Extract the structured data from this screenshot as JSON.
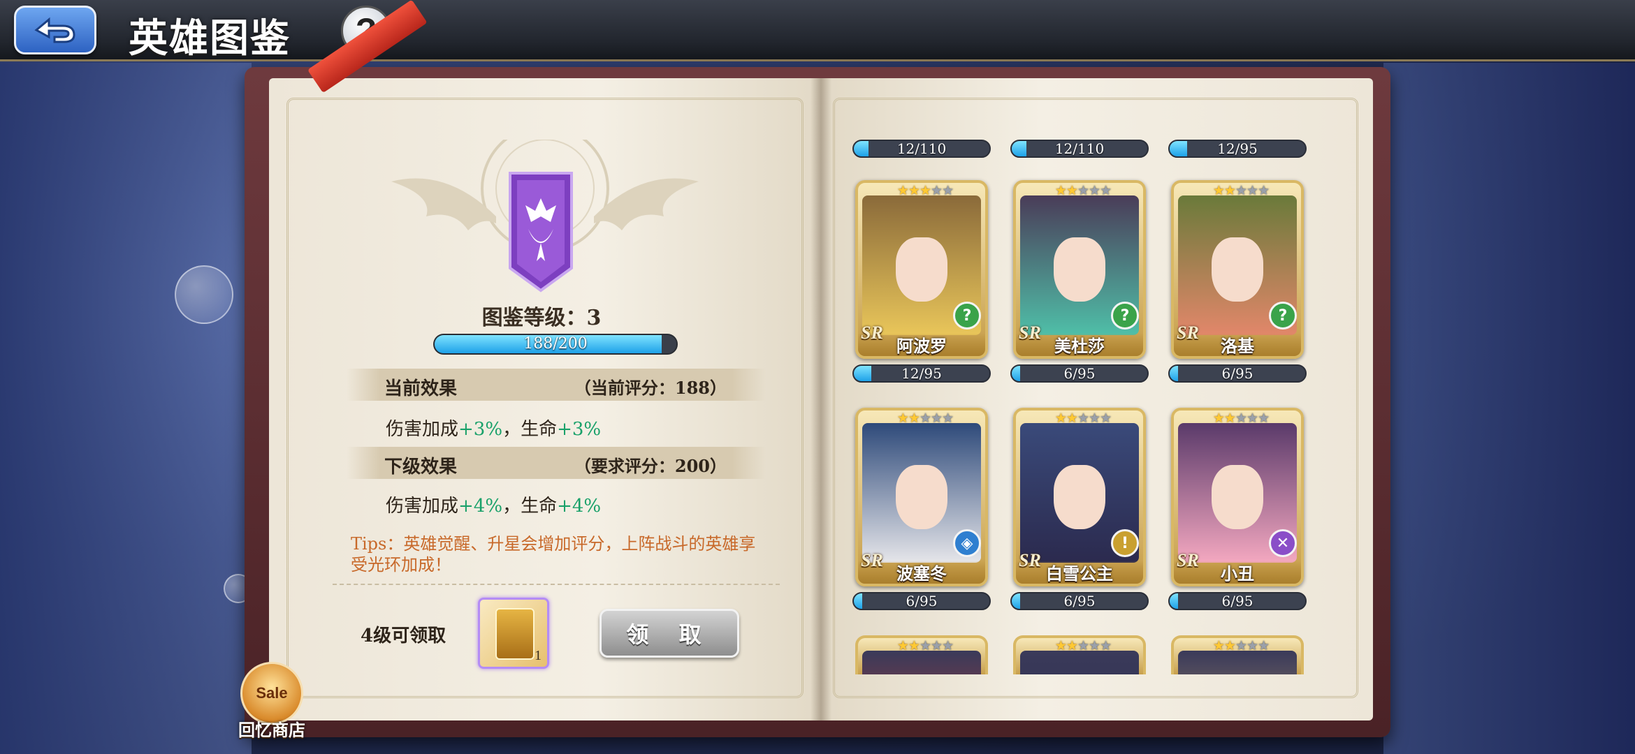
{
  "header": {
    "title": "英雄图鉴",
    "back_icon": "back-arrow-icon",
    "help_symbol": "?"
  },
  "collection": {
    "level_label": "图鉴等级：3",
    "progress_text": "188/200",
    "progress_fraction": 0.94,
    "current_effect": {
      "title": "当前效果",
      "score": "（当前评分：188）",
      "effect_prefix_1": "伤害加成",
      "effect_value_1": "+3%",
      "effect_mid": "，生命",
      "effect_value_2": "+3%"
    },
    "next_effect": {
      "title": "下级效果",
      "score": "（要求评分：200）",
      "effect_prefix_1": "伤害加成",
      "effect_value_1": "+4%",
      "effect_mid": "，生命",
      "effect_value_2": "+4%"
    },
    "tips": "Tips：英雄觉醒、升星会增加评分，上阵战斗的英雄享受光环加成！",
    "claim_condition": "4级可领取",
    "reward_count": "1",
    "claim_button": "领 取"
  },
  "shop": {
    "icon_text": "Sale",
    "label": "回忆商店"
  },
  "top_bars": [
    {
      "text": "12/110",
      "fraction": 0.11
    },
    {
      "text": "12/110",
      "fraction": 0.11
    },
    {
      "text": "12/95",
      "fraction": 0.13
    }
  ],
  "heroes": [
    {
      "name": "阿波罗",
      "rarity": "SR",
      "stars": 3,
      "progress": "12/95",
      "fraction": 0.13,
      "class_symbol": "?",
      "class_color": "#3aa34a",
      "hair": "#e9c65a",
      "bg": "#8a6a3a"
    },
    {
      "name": "美杜莎",
      "rarity": "SR",
      "stars": 2,
      "progress": "6/95",
      "fraction": 0.06,
      "class_symbol": "?",
      "class_color": "#3aa34a",
      "hair": "#4fbfa8",
      "bg": "#4a3c58"
    },
    {
      "name": "洛基",
      "rarity": "SR",
      "stars": 2,
      "progress": "6/95",
      "fraction": 0.06,
      "class_symbol": "?",
      "class_color": "#3aa34a",
      "hair": "#e2876a",
      "bg": "#6a7a3a"
    },
    {
      "name": "波塞冬",
      "rarity": "SR",
      "stars": 2,
      "progress": "6/95",
      "fraction": 0.06,
      "class_symbol": "◈",
      "class_color": "#2f7fd0",
      "hair": "#e6e6ea",
      "bg": "#2e4a7a"
    },
    {
      "name": "白雪公主",
      "rarity": "SR",
      "stars": 2,
      "progress": "6/95",
      "fraction": 0.06,
      "class_symbol": "!",
      "class_color": "#c9a030",
      "hair": "#2b2a4e",
      "bg": "#3a4a7a"
    },
    {
      "name": "小丑",
      "rarity": "SR",
      "stars": 2,
      "progress": "6/95",
      "fraction": 0.06,
      "class_symbol": "✕",
      "class_color": "#8a4ec8",
      "hair": "#f4a8c0",
      "bg": "#5a3a6a"
    }
  ],
  "bottom_partial": [
    {
      "stars": 2,
      "hair": "#d23a2a"
    },
    {
      "stars": 2,
      "hair": "#2a2a4a"
    },
    {
      "stars": 2,
      "hair": "#c9a56a"
    }
  ],
  "colors": {
    "accent_blue": "#1ea1e8",
    "green_value": "#1aa16a",
    "tips_orange": "#c8692a",
    "card_gold": "#d9b864"
  }
}
